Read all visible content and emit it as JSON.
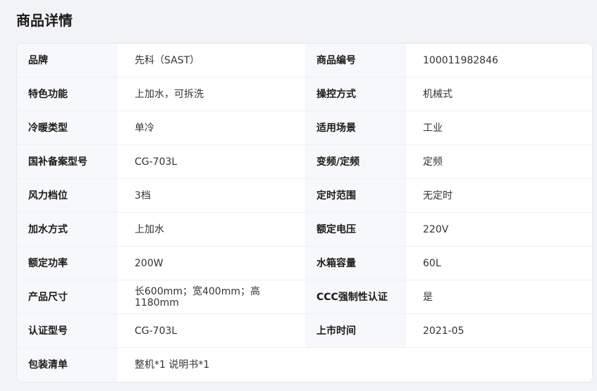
{
  "section": {
    "title": "商品详情"
  },
  "specs": [
    {
      "k1": "品牌",
      "v1": "先科（SAST）",
      "k2": "商品编号",
      "v2": "100011982846"
    },
    {
      "k1": "特色功能",
      "v1": "上加水，可拆洗",
      "k2": "操控方式",
      "v2": "机械式"
    },
    {
      "k1": "冷暖类型",
      "v1": "单冷",
      "k2": "适用场景",
      "v2": "工业"
    },
    {
      "k1": "国补备案型号",
      "v1": "CG-703L",
      "k2": "变频/定频",
      "v2": "定频"
    },
    {
      "k1": "风力档位",
      "v1": "3档",
      "k2": "定时范围",
      "v2": "无定时"
    },
    {
      "k1": "加水方式",
      "v1": "上加水",
      "k2": "额定电压",
      "v2": "220V"
    },
    {
      "k1": "额定功率",
      "v1": "200W",
      "k2": "水箱容量",
      "v2": "60L"
    },
    {
      "k1": "产品尺寸",
      "v1": "长600mm；宽400mm；高1180mm",
      "k2": "CCC强制性认证",
      "v2": "是"
    },
    {
      "k1": "认证型号",
      "v1": "CG-703L",
      "k2": "上市时间",
      "v2": "2021-05"
    },
    {
      "k1": "包装清单",
      "v1": "整机*1 说明书*1"
    }
  ]
}
